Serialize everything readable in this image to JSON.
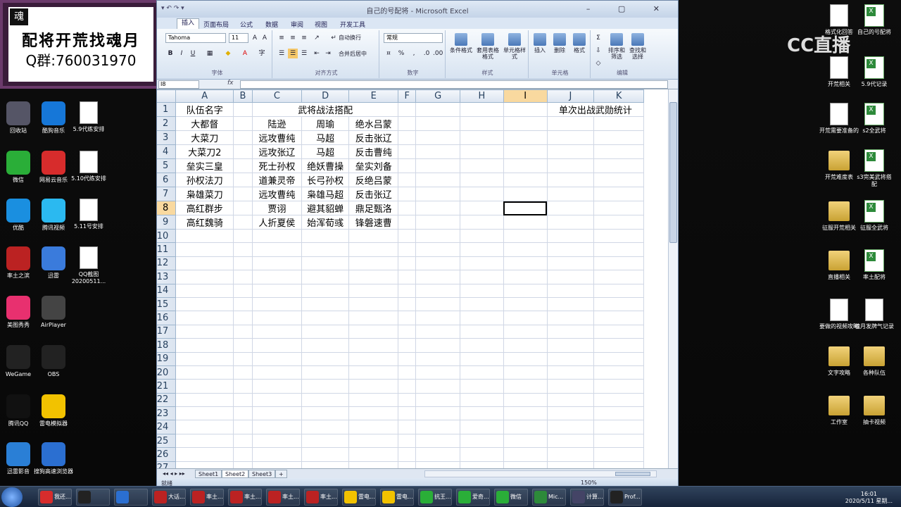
{
  "banner": {
    "logo": "魂",
    "line1": "配将开荒找魂月",
    "line2": "Q群:760031970"
  },
  "cc_logo": "CC直播",
  "desktop_left": [
    {
      "label": "回收站",
      "color": "#556"
    },
    {
      "label": "酷狗音乐",
      "color": "#1677d8"
    },
    {
      "label": "5.9代练安排",
      "color": "doc"
    },
    {
      "label": "微信",
      "color": "#2aae38"
    },
    {
      "label": "网易云音乐",
      "color": "#d72c2c"
    },
    {
      "label": "5.10代练安排",
      "color": "doc"
    },
    {
      "label": "优酷",
      "color": "#1a8fe0"
    },
    {
      "label": "腾讯视频",
      "color": "#2bb9f0"
    },
    {
      "label": "5.11号安排",
      "color": "doc"
    },
    {
      "label": "率土之滨",
      "color": "#b22"
    },
    {
      "label": "迅雷",
      "color": "#3a7bdc"
    },
    {
      "label": "QQ截图20200511...",
      "color": "doc"
    },
    {
      "label": "美图秀秀",
      "color": "#e8306f"
    },
    {
      "label": "AirPlayer",
      "color": "#444"
    },
    {
      "label": "WeGame",
      "color": "#222"
    },
    {
      "label": "OBS",
      "color": "#222"
    },
    {
      "label": "腾讯QQ",
      "color": "#111"
    },
    {
      "label": "雷电模拟器",
      "color": "#f2c200"
    },
    {
      "label": "迅雷影音",
      "color": "#2a7fd6"
    },
    {
      "label": "搜狗高速浏览器",
      "color": "#2b6fd1"
    }
  ],
  "desktop_right": [
    {
      "label": "格式化回答",
      "kind": "doc"
    },
    {
      "label": "自己的号配将",
      "kind": "xls"
    },
    {
      "label": "开荒相关",
      "kind": "doc"
    },
    {
      "label": "5.9代记录",
      "kind": "xls"
    },
    {
      "label": "开荒需要准备的",
      "kind": "doc"
    },
    {
      "label": "s2全武将",
      "kind": "xls"
    },
    {
      "label": "开荒难度表",
      "kind": "folder"
    },
    {
      "label": "s3完美武将搭配",
      "kind": "xls"
    },
    {
      "label": "征服开荒相关",
      "kind": "folder"
    },
    {
      "label": "征服全武将",
      "kind": "xls"
    },
    {
      "label": "直播相关",
      "kind": "folder"
    },
    {
      "label": "率土配将",
      "kind": "xls"
    },
    {
      "label": "要做的视频攻略",
      "kind": "doc"
    },
    {
      "label": "魂月发牌气记录",
      "kind": "doc"
    },
    {
      "label": "文字攻略",
      "kind": "folder"
    },
    {
      "label": "各种队伍",
      "kind": "folder"
    },
    {
      "label": "工作室",
      "kind": "folder"
    },
    {
      "label": "抽卡视频",
      "kind": "folder"
    }
  ],
  "excel": {
    "title": "自己的号配将 - Microsoft Excel",
    "quick_access": "▾ ↶ ↷ ▾",
    "window_controls": "– ▢ ✕",
    "tabs": [
      "插入",
      "页面布局",
      "公式",
      "数据",
      "审阅",
      "视图",
      "开发工具"
    ],
    "font_name": "Tahoma",
    "font_size": "11",
    "number_format": "常规",
    "wrap_text": "自动换行",
    "merge_center": "合并后居中",
    "groups": [
      "字体",
      "对齐方式",
      "数字",
      "样式",
      "单元格",
      "编辑"
    ],
    "big_buttons": [
      "条件格式",
      "套用表格格式",
      "单元格样式",
      "插入",
      "删除",
      "格式",
      "排序和筛选",
      "查找和选择"
    ],
    "name_box": "I8",
    "fx": "fx",
    "columns": [
      "A",
      "B",
      "C",
      "D",
      "E",
      "F",
      "G",
      "H",
      "I",
      "J",
      "K"
    ],
    "selected_column": "I",
    "selected_row": 8,
    "rows": [
      {
        "n": 1,
        "a": "队伍名字",
        "c": "武将战法搭配",
        "j": "单次出战武勋统计"
      },
      {
        "n": 2,
        "a": "大都督",
        "c": "陆逊",
        "d": "周瑜",
        "e": "绝水吕蒙"
      },
      {
        "n": 3,
        "a": "大菜刀",
        "c": "远攻曹纯",
        "d": "马超",
        "e": "反击张辽"
      },
      {
        "n": 4,
        "a": "大菜刀2",
        "c": "远攻张辽",
        "d": "马超",
        "e": "反击曹纯"
      },
      {
        "n": 5,
        "a": "垒实三皇",
        "c": "死士孙权",
        "d": "绝妖曹操",
        "e": "垒实刘备"
      },
      {
        "n": 6,
        "a": "孙权法刀",
        "c": "道兼灵帝",
        "d": "长弓孙权",
        "e": "反绝吕蒙"
      },
      {
        "n": 7,
        "a": "枭雄菜刀",
        "c": "远攻曹纯",
        "d": "枭雄马超",
        "e": "反击张辽"
      },
      {
        "n": 8,
        "a": "高红群步",
        "c": "贾诩",
        "d": "避其貂蝉",
        "e": "鼎足甄洛"
      },
      {
        "n": 9,
        "a": "高红魏骑",
        "c": "人折夏侯",
        "d": "始浑荀彧",
        "e": "锋磐速曹"
      },
      {
        "n": 10
      },
      {
        "n": 11
      },
      {
        "n": 12
      },
      {
        "n": 13
      },
      {
        "n": 14
      },
      {
        "n": 15
      },
      {
        "n": 16
      },
      {
        "n": 17
      },
      {
        "n": 18
      },
      {
        "n": 19
      },
      {
        "n": 20
      },
      {
        "n": 21
      },
      {
        "n": 22
      },
      {
        "n": 23
      },
      {
        "n": 24
      },
      {
        "n": 25
      },
      {
        "n": 26
      },
      {
        "n": 27
      }
    ],
    "sheets": [
      "Sheet1",
      "Sheet2",
      "Sheet3"
    ],
    "active_sheet": "Sheet2",
    "status": "就绪",
    "zoom": "150%"
  },
  "taskbar": {
    "buttons": [
      {
        "label": "我还...",
        "color": "#d72c2c"
      },
      {
        "label": "",
        "color": "#222"
      },
      {
        "label": "",
        "color": "#2b6fd1"
      },
      {
        "label": "大话...",
        "color": "#b22"
      },
      {
        "label": "率土...",
        "color": "#b22"
      },
      {
        "label": "率土...",
        "color": "#b22"
      },
      {
        "label": "率土...",
        "color": "#b22"
      },
      {
        "label": "率土...",
        "color": "#b22"
      },
      {
        "label": "雷电...",
        "color": "#f2c200"
      },
      {
        "label": "雷电...",
        "color": "#f2c200"
      },
      {
        "label": "抗王...",
        "color": "#2aae38"
      },
      {
        "label": "爱奇...",
        "color": "#2aae38"
      },
      {
        "label": "微信",
        "color": "#2aae38"
      },
      {
        "label": "Mic...",
        "color": "#2d8a3a"
      },
      {
        "label": "计算...",
        "color": "#446"
      },
      {
        "label": "Prof...",
        "color": "#222"
      }
    ],
    "time": "16:01",
    "date": "2020/5/11 星期..."
  }
}
